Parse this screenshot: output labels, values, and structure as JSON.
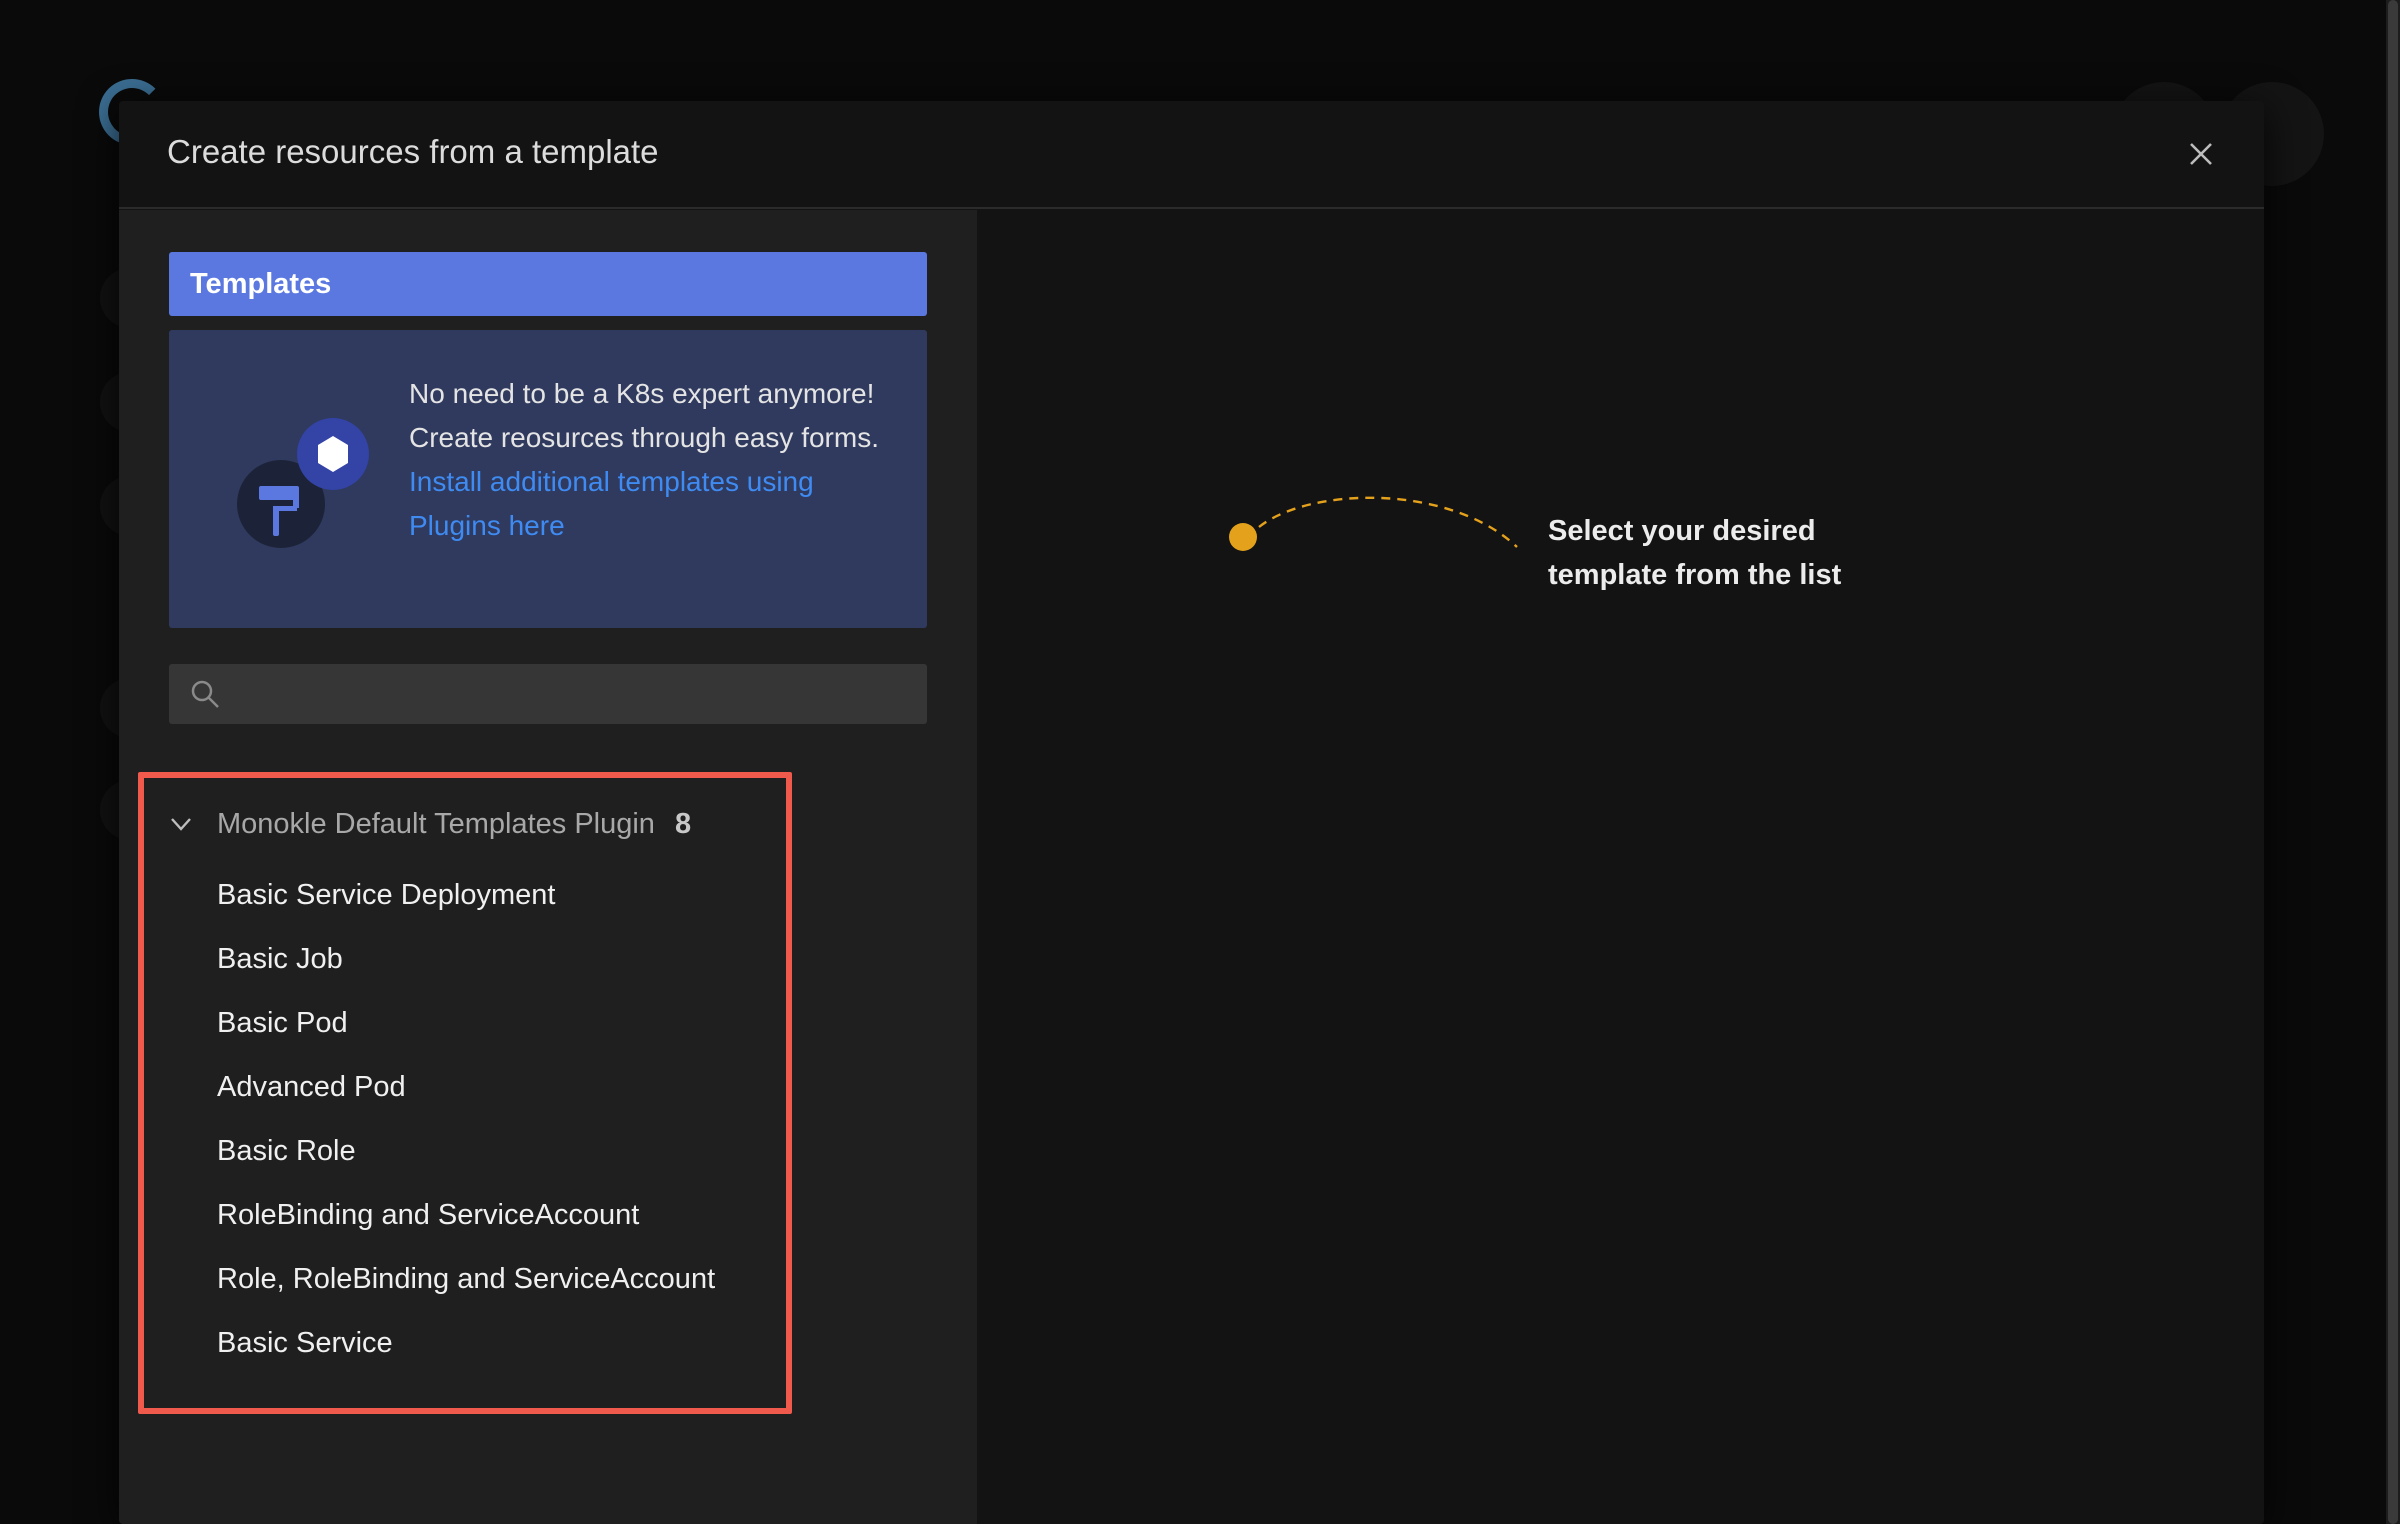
{
  "modal": {
    "title": "Create resources from a template",
    "close_icon": "close-icon"
  },
  "sidebar": {
    "tab_label": "Templates",
    "info": {
      "text": "No need to be a K8s expert anymore! Create reosurces through easy forms.",
      "link": "Install additional templates using Plugins here",
      "illustration_icon": "paint-roller-icon"
    },
    "search": {
      "value": "",
      "placeholder": "",
      "icon": "search-icon"
    }
  },
  "plugin": {
    "name": "Monokle Default Templates Plugin",
    "count": "8",
    "expanded": true,
    "templates": [
      {
        "label": "Basic Service Deployment"
      },
      {
        "label": "Basic Job"
      },
      {
        "label": "Basic Pod"
      },
      {
        "label": "Advanced Pod"
      },
      {
        "label": "Basic Role"
      },
      {
        "label": "RoleBinding and ServiceAccount"
      },
      {
        "label": "Role, RoleBinding and ServiceAccount"
      },
      {
        "label": "Basic Service"
      }
    ]
  },
  "hint": {
    "text": "Select your desired template from the list"
  },
  "colors": {
    "accent": "#5a78e0",
    "link": "#3f8bf2",
    "highlight": "#ef5a4c",
    "hint_dot": "#e4a11b",
    "info_bg": "#2f3a5e"
  }
}
